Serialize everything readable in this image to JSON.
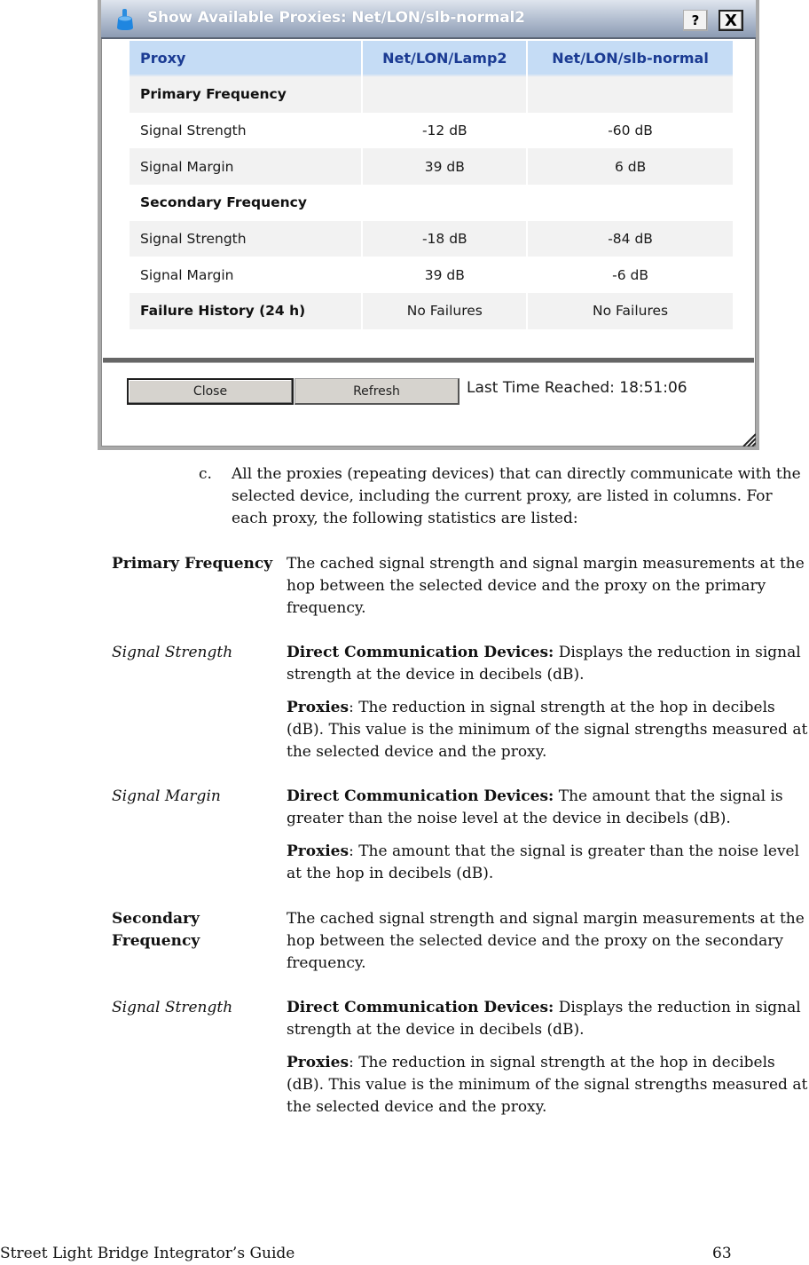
{
  "dialog": {
    "title": "Show Available Proxies: Net/LON/slb-normal2",
    "help_button": "?",
    "close_x_button": "X",
    "table": {
      "header": [
        "Proxy",
        "Net/LON/Lamp2",
        "Net/LON/slb-normal"
      ],
      "rows": [
        {
          "label": "Primary Frequency",
          "values": [
            "",
            ""
          ],
          "section": true
        },
        {
          "label": "Signal Strength",
          "values": [
            "-12 dB",
            "-60 dB"
          ],
          "section": false
        },
        {
          "label": "Signal Margin",
          "values": [
            "39 dB",
            "6 dB"
          ],
          "section": false
        },
        {
          "label": "Secondary Frequency",
          "values": [
            "",
            ""
          ],
          "section": true
        },
        {
          "label": "Signal Strength",
          "values": [
            "-18 dB",
            "-84 dB"
          ],
          "section": false
        },
        {
          "label": "Signal Margin",
          "values": [
            "39 dB",
            "-6 dB"
          ],
          "section": false
        },
        {
          "label": "Failure History (24 h)",
          "values": [
            "No Failures",
            "No Failures"
          ],
          "section": true
        }
      ]
    },
    "buttons": {
      "close": "Close",
      "refresh": "Refresh"
    },
    "last_time_reached": "Last Time Reached: 18:51:06"
  },
  "document": {
    "step": {
      "marker": "c.",
      "text": "All the proxies (repeating devices) that can directly communicate with the selected device, including the current proxy, are listed in columns.  For each proxy, the following statistics are listed:"
    },
    "definitions": [
      {
        "term": "Primary Frequency",
        "style": "bold",
        "paragraphs": [
          {
            "lead": "",
            "text": "The cached signal strength and signal margin measurements at the hop between the selected device and the proxy on the primary frequency."
          }
        ]
      },
      {
        "term": "Signal Strength",
        "style": "italic",
        "paragraphs": [
          {
            "lead": "Direct Communication Devices:",
            "text": "  Displays the reduction in signal strength at the device in decibels (dB)."
          },
          {
            "lead": "Proxies",
            "text": ": The reduction in signal strength at the hop in decibels (dB).  This value is the minimum of the signal strengths measured at the selected device and the proxy."
          }
        ]
      },
      {
        "term": "Signal Margin",
        "style": "italic",
        "paragraphs": [
          {
            "lead": "Direct Communication Devices:",
            "text": "  The amount that the signal is greater than the noise level at the device in decibels (dB)."
          },
          {
            "lead": "Proxies",
            "text": ": The amount that the signal is greater than the noise level at the hop in decibels (dB)."
          }
        ]
      },
      {
        "term": "Secondary Frequency",
        "style": "bold",
        "paragraphs": [
          {
            "lead": "",
            "text": "The cached signal strength and signal margin measurements at the hop between the selected device and the proxy on the secondary frequency."
          }
        ]
      },
      {
        "term": "Signal Strength",
        "style": "italic",
        "paragraphs": [
          {
            "lead": "Direct Communication Devices:",
            "text": "  Displays the reduction in signal strength at the device in decibels (dB)."
          },
          {
            "lead": "Proxies",
            "text": ": The reduction in signal strength at the hop in decibels (dB).  This value is the minimum of the signal strengths measured at the selected device and the proxy."
          }
        ]
      }
    ]
  },
  "footer": {
    "title": "Street Light Bridge Integrator’s Guide",
    "page_number": "63"
  }
}
